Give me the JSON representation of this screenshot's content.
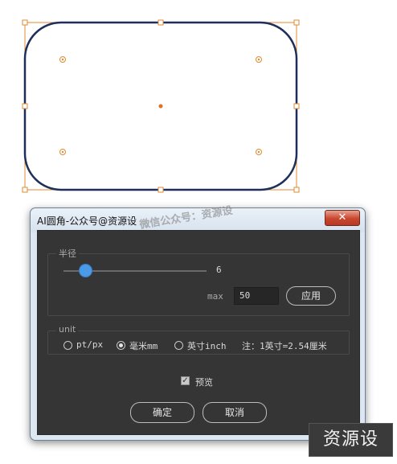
{
  "dialog": {
    "title": "AI圆角-公众号@资源设",
    "close_glyph": "✕",
    "watermark": "微信公众号：资源设",
    "radius_group": {
      "title": "半径",
      "slider_value": "6",
      "slider_fraction": 0.15,
      "max_label": "max",
      "max_value": "50",
      "apply_label": "应用"
    },
    "unit_group": {
      "title": "unit",
      "options": [
        {
          "label": "pt/px",
          "checked": false
        },
        {
          "label": "毫米mm",
          "checked": true
        },
        {
          "label": "英寸inch",
          "checked": false
        }
      ],
      "note": "注：1英寸=2.54厘米"
    },
    "preview": {
      "label": "预览",
      "checked": true
    },
    "ok_label": "确定",
    "cancel_label": "取消"
  },
  "logo": {
    "text": "资源设"
  },
  "colors": {
    "shape_stroke": "#1d2f5a",
    "bbox": "#e08a2f",
    "panel": "#353535",
    "slider_thumb": "#4a9ae8"
  }
}
